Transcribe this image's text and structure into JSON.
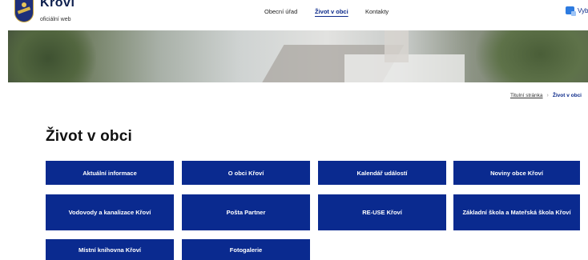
{
  "header": {
    "brand_title": "Křoví",
    "brand_subtitle": "oficiální web",
    "nav": [
      {
        "label": "Obecní úřad"
      },
      {
        "label": "Život v obci"
      },
      {
        "label": "Kontakty"
      }
    ],
    "language_label": "Vyb"
  },
  "breadcrumb": {
    "home": "Titulní stránka",
    "separator": "›",
    "current": "Život v obci"
  },
  "page_title": "Život v obci",
  "tiles": [
    {
      "label": "Aktuální informace"
    },
    {
      "label": "O obci Křoví"
    },
    {
      "label": "Kalendář událostí"
    },
    {
      "label": "Noviny obce Křoví"
    },
    {
      "label": "Vodovody a kanalizace Křoví"
    },
    {
      "label": "Pošta Partner"
    },
    {
      "label": "RE-USE Křoví"
    },
    {
      "label": "Základní škola a Mateřská škola Křoví"
    },
    {
      "label": "Místní knihovna Křoví"
    },
    {
      "label": "Fotogalerie"
    }
  ],
  "colors": {
    "tile_background": "#0a2a8f",
    "accent": "#0c2a8a"
  }
}
